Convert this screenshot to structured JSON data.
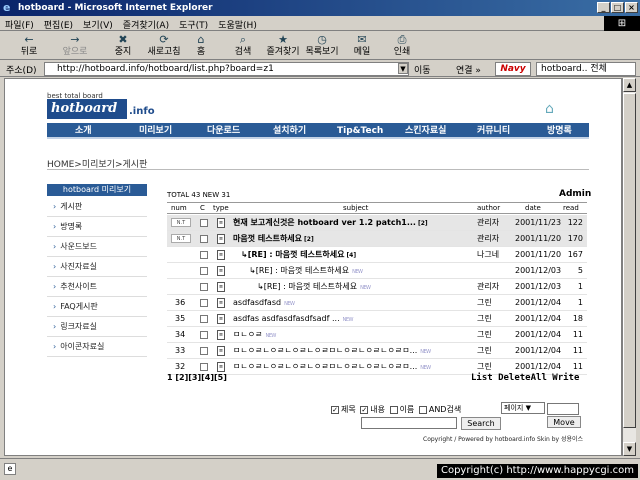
{
  "window": {
    "title": "hotboard - Microsoft Internet Explorer",
    "min": "_",
    "max": "□",
    "close": "×"
  },
  "menu": [
    "파일(F)",
    "편집(E)",
    "보기(V)",
    "즐겨찾기(A)",
    "도구(T)",
    "도움말(H)"
  ],
  "toolbar": [
    {
      "icon": "←",
      "label": "뒤로"
    },
    {
      "icon": "→",
      "label": "앞으로"
    },
    {
      "icon": "✖",
      "label": "중지"
    },
    {
      "icon": "⟳",
      "label": "새로고침"
    },
    {
      "icon": "⌂",
      "label": "홈"
    },
    {
      "icon": "⌕",
      "label": "검색"
    },
    {
      "icon": "★",
      "label": "즐겨찾기"
    },
    {
      "icon": "◷",
      "label": "목록보기"
    },
    {
      "icon": "✉",
      "label": "메일"
    },
    {
      "icon": "⎙",
      "label": "인쇄"
    }
  ],
  "address": {
    "label": "주소(D)",
    "url": "http://hotboard.info/hotboard/list.php?board=z1",
    "go": "이동",
    "links": "연결 »",
    "navy": "Navy",
    "search_value": "hotboard..",
    "search_extra": "전체"
  },
  "site": {
    "tagline": "best total board",
    "logo": "hotboard",
    "logo_suffix": ".info",
    "nav": [
      "소개",
      "미리보기",
      "다운로드",
      "설치하기",
      "Tip&Tech",
      "스킨자료실",
      "커뮤니티",
      "방명록"
    ],
    "breadcrumb": "HOME>미리보기>게시판",
    "sidebar_title": "hotboard 미리보기",
    "sidebar": [
      "게시판",
      "방명록",
      "사운드보드",
      "사진자료실",
      "추천사이트",
      "FAQ게시판",
      "링크자료실",
      "아이콘자료실"
    ],
    "total": "TOTAL 43 NEW 31",
    "admin": "Admin",
    "columns": {
      "num": "num",
      "c": "C",
      "type": "type",
      "subject": "subject",
      "author": "author",
      "date": "date",
      "read": "read"
    },
    "rows": [
      {
        "num": "",
        "notice": "N.T",
        "subject": "현재 보고계신것은 hotboard ver 1.2 patch1...",
        "count": "[2]",
        "new": false,
        "author": "관리자",
        "date": "2001/11/23",
        "read": "122",
        "bold": true,
        "hl": true,
        "indent": 0
      },
      {
        "num": "",
        "notice": "N.T",
        "subject": "마음껏 테스트하세요",
        "count": "[2]",
        "new": false,
        "author": "관리자",
        "date": "2001/11/20",
        "read": "170",
        "bold": true,
        "hl": true,
        "indent": 0
      },
      {
        "num": "",
        "notice": "",
        "subject": "↳[RE] : 마음껏 테스트하세요",
        "count": "[4]",
        "new": false,
        "author": "나그네",
        "date": "2001/11/20",
        "read": "167",
        "bold": true,
        "hl": false,
        "indent": 1
      },
      {
        "num": "",
        "notice": "",
        "subject": "↳[RE] : 마음껏 테스트하세요",
        "count": "",
        "new": true,
        "author": "",
        "date": "2001/12/03",
        "read": "5",
        "bold": false,
        "hl": false,
        "indent": 2
      },
      {
        "num": "",
        "notice": "",
        "subject": "↳[RE] : 마음껏 테스트하세요",
        "count": "",
        "new": true,
        "author": "관리자",
        "date": "2001/12/03",
        "read": "1",
        "bold": false,
        "hl": false,
        "indent": 3
      },
      {
        "num": "36",
        "notice": "",
        "subject": "asdfasdfasd",
        "count": "",
        "new": true,
        "author": "그린",
        "date": "2001/12/04",
        "read": "1",
        "bold": false,
        "hl": false,
        "indent": 0
      },
      {
        "num": "35",
        "notice": "",
        "subject": "asdfas asdfasdfasdfsadf ...",
        "count": "",
        "new": true,
        "author": "그린",
        "date": "2001/12/04",
        "read": "18",
        "bold": false,
        "hl": false,
        "indent": 0
      },
      {
        "num": "34",
        "notice": "",
        "subject": "ㅁㄴㅇㄹ",
        "count": "",
        "new": true,
        "author": "그린",
        "date": "2001/12/04",
        "read": "11",
        "bold": false,
        "hl": false,
        "indent": 0
      },
      {
        "num": "33",
        "notice": "",
        "subject": "ㅁㄴㅇㄹㄴㅇㄹㄴㅇㄹㄴㅇㄹㅁㄴㅇㄹㄴㅇㄹㄴㅇㄹㅁ...",
        "count": "",
        "new": true,
        "author": "그린",
        "date": "2001/12/04",
        "read": "11",
        "bold": false,
        "hl": false,
        "indent": 0
      },
      {
        "num": "32",
        "notice": "",
        "subject": "ㅁㄴㅇㄹㄴㅇㄹㄴㅇㄹㄴㅇㄹㅁㄴㅇㄹㄴㅇㄹㄴㅇㄹㅁ...",
        "count": "",
        "new": true,
        "author": "그린",
        "date": "2001/12/04",
        "read": "11",
        "bold": false,
        "hl": false,
        "indent": 0
      }
    ],
    "new_mark": "NEW",
    "pager": "1 [2][3][4][5]",
    "actions": "List DeleteAll Write",
    "search": {
      "subject": "제목",
      "content": "내용",
      "name": "이름",
      "and": "AND검색",
      "button": "Search"
    },
    "page_select": "페이지",
    "move": "Move",
    "footer": "Copyright / Powered by hotboard.info Skin by 성용이스"
  },
  "status": {
    "copyright": "Copyright(c) http://www.happycgi.com"
  },
  "colors": {
    "accent": "#2a5b96",
    "titlebar": "#0a246a"
  }
}
